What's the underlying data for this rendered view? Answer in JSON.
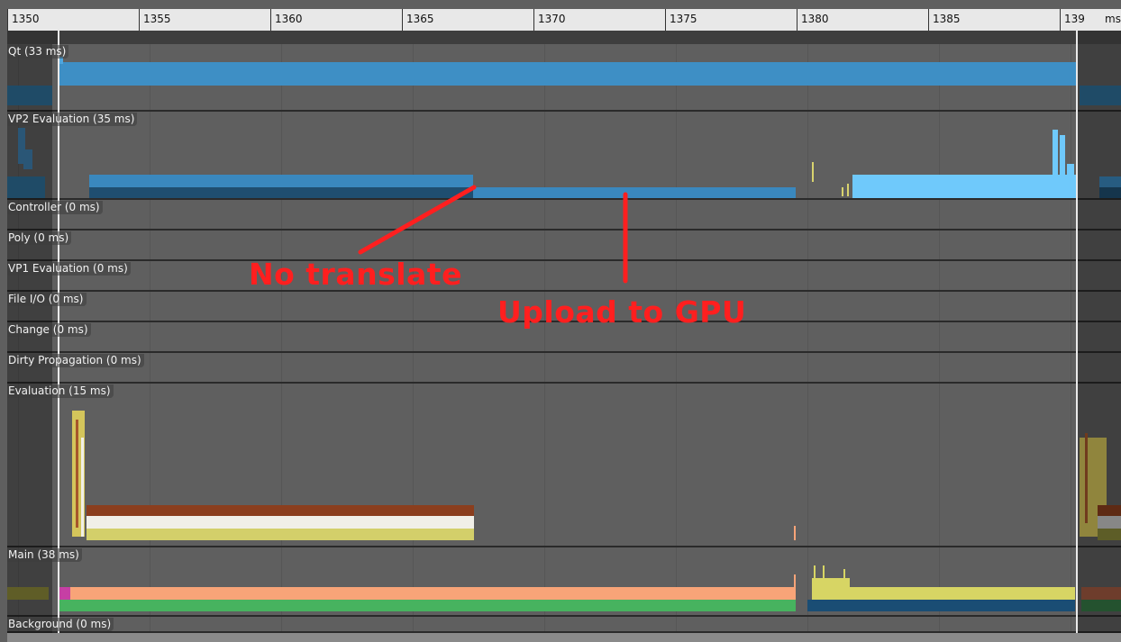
{
  "ruler": {
    "ticks": [
      "1350",
      "1355",
      "1360",
      "1365",
      "1370",
      "1375",
      "1380",
      "1385",
      "139"
    ],
    "unit": "ms"
  },
  "lanes": [
    {
      "id": "qt",
      "label": "Qt (33 ms)"
    },
    {
      "id": "vp2",
      "label": "VP2 Evaluation (35 ms)"
    },
    {
      "id": "controller",
      "label": "Controller (0 ms)"
    },
    {
      "id": "poly",
      "label": "Poly (0 ms)"
    },
    {
      "id": "vp1",
      "label": "VP1 Evaluation (0 ms)"
    },
    {
      "id": "fileio",
      "label": "File I/O (0 ms)"
    },
    {
      "id": "change",
      "label": "Change (0 ms)"
    },
    {
      "id": "dirty",
      "label": "Dirty Propagation (0 ms)"
    },
    {
      "id": "evaluation",
      "label": "Evaluation (15 ms)"
    },
    {
      "id": "main",
      "label": "Main (38 ms)"
    },
    {
      "id": "background",
      "label": "Background (0 ms)"
    }
  ],
  "annotations": {
    "no_translate": "No translate",
    "upload_gpu": "Upload to GPU",
    "color": "#ff1f1f"
  },
  "colors": {
    "qt_bar": "#3e8fc5",
    "vp2_dark": "#1f4e70",
    "vp2_mid": "#3a88be",
    "vp2_light": "#6fc9fb",
    "eval_brown": "#8b3e1e",
    "eval_white": "#f1efe8",
    "eval_yellow": "#d3cf6a",
    "main_salmon": "#f8a478",
    "main_green": "#47b35f",
    "main_yellow": "#d7d564",
    "main_navy": "#1a4d74"
  }
}
